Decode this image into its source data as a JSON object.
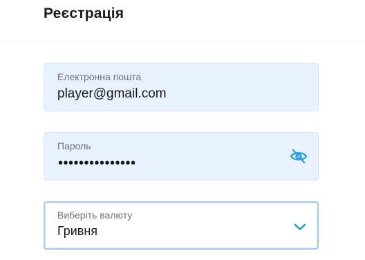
{
  "header": {
    "title": "Реєстрація"
  },
  "form": {
    "email": {
      "label": "Електронна пошта",
      "value": "player@gmail.com"
    },
    "password": {
      "label": "Пароль",
      "masked_value": "•••••••••••••••",
      "toggle_icon": "eye-off-icon"
    },
    "currency": {
      "label": "Виберіть валюту",
      "selected": "Гривня",
      "icon": "chevron-down-icon"
    }
  },
  "colors": {
    "accent": "#2a9fd8",
    "field_bg": "#e8f1fd"
  }
}
